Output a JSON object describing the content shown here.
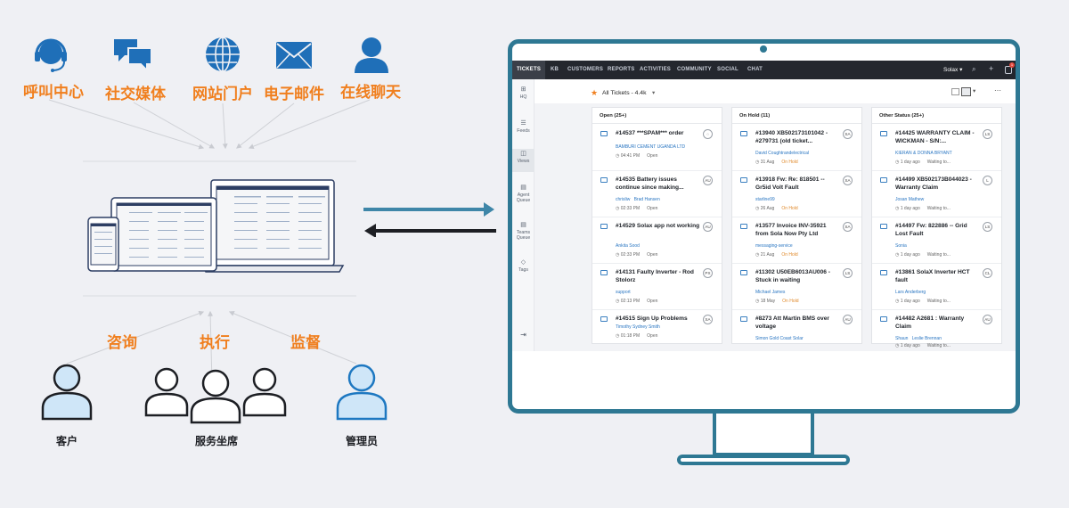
{
  "channels": [
    {
      "label": "呼叫中心",
      "icon": "headset-icon"
    },
    {
      "label": "社交媒体",
      "icon": "chat-bubbles-icon"
    },
    {
      "label": "网站门户",
      "icon": "globe-icon"
    },
    {
      "label": "电子邮件",
      "icon": "envelope-icon"
    },
    {
      "label": "在线聊天",
      "icon": "user-icon"
    }
  ],
  "interactions": [
    "咨询",
    "执行",
    "监督"
  ],
  "roles": {
    "customer": "客户",
    "agents": "服务坐席",
    "admin": "管理员"
  },
  "colors": {
    "accent_orange": "#f07f1e",
    "brand_blue": "#1f6fb8",
    "monitor_frame": "#2e7893",
    "arrow_teal": "#3e86a8",
    "nav_dark": "#24272e"
  },
  "helpdesk": {
    "nav_tabs": [
      "TICKETS",
      "KB",
      "CUSTOMERS",
      "REPORTS",
      "ACTIVITIES",
      "COMMUNITY",
      "SOCIAL",
      "CHAT"
    ],
    "org_name": "Solax",
    "notification_count": "1",
    "sidebar": [
      "HQ",
      "Feeds",
      "Views",
      "Agent Queue",
      "Teams Queue",
      "Tags"
    ],
    "view_title": "All Tickets - 4.4k",
    "columns": [
      {
        "header": "Open (25+)",
        "tickets": [
          {
            "title": "#14537  ***SPAM*** order",
            "contact": "BAMBURI CEMENT UGANDA LTD",
            "agent": "",
            "time": "04:41 PM",
            "status": "Open",
            "avatar": ""
          },
          {
            "title": "#14535  Battery issues continue since making...",
            "contact": "chrisliw",
            "agent": "Brad Hansen",
            "time": "02:33 PM",
            "status": "Open",
            "avatar": "AU"
          },
          {
            "title": "#14529  Solax app not working",
            "contact": "Ankita Sood",
            "agent": "",
            "time": "02:33 PM",
            "status": "Open",
            "avatar": "AU"
          },
          {
            "title": "#14131  Faulty Inverter - Rod Stolorz",
            "contact": "support",
            "agent": "",
            "time": "02:13 PM",
            "status": "Open",
            "avatar": "PX"
          },
          {
            "title": "#14515  Sign Up Problems",
            "contact": "Timothy Sydney Smith",
            "agent": "",
            "time": "01:18 PM",
            "status": "Open",
            "avatar": "SA"
          }
        ]
      },
      {
        "header": "On Hold (11)",
        "tickets": [
          {
            "title": "#13940  XB502173101042 - #279731 (old ticket...",
            "contact": "David Coughtrandelectrical",
            "agent": "",
            "time": "31 Aug",
            "status": "On Hold",
            "avatar": "SA"
          },
          {
            "title": "#13918  Fw: Re: 818501 -- Gr5id Volt Fault",
            "contact": "starline99",
            "agent": "",
            "time": "26 Aug",
            "status": "On Hold",
            "avatar": "SA"
          },
          {
            "title": "#13577  Invoice INV-35921 from Sola Now Pty Ltd",
            "contact": "messaging-service",
            "agent": "",
            "time": "21 Aug",
            "status": "On Hold",
            "avatar": "SA"
          },
          {
            "title": "#11302  U50EB6013AU006 - Stuck in waiting",
            "contact": "Michael James",
            "agent": "",
            "time": "18 May",
            "status": "On Hold",
            "avatar": "LS"
          },
          {
            "title": "#8273  Att Martin BMS over voltage",
            "contact": "Simon Gold Coast Solar",
            "agent": "",
            "time": "",
            "status": "",
            "avatar": "AU"
          }
        ]
      },
      {
        "header": "Other Status (25+)",
        "tickets": [
          {
            "title": "#14425  WARRANTY CLAIM - WICKMAN - S/N:...",
            "contact": "KIERAN & DONNA BRYANT",
            "agent": "",
            "time": "1 day ago",
            "status": "Waiting to...",
            "avatar": "LS"
          },
          {
            "title": "#14499  XB502173B044023 - Warranty Claim",
            "contact": "Josan Mathew",
            "agent": "",
            "time": "1 day ago",
            "status": "Waiting to...",
            "avatar": "L"
          },
          {
            "title": "#14497  Fw: 822886 -- Grid Lost Fault",
            "contact": "Sonia",
            "agent": "",
            "time": "1 day ago",
            "status": "Waiting to...",
            "avatar": "LS"
          },
          {
            "title": "#13861  SolaX Inverter HCT fault",
            "contact": "Lars Anderberg",
            "agent": "",
            "time": "1 day ago",
            "status": "Waiting to...",
            "avatar": "CL"
          },
          {
            "title": "#14482  A2681 : Warranty Claim",
            "contact": "Shaun",
            "agent": "Leslie Brennan",
            "time": "1 day ago",
            "status": "Waiting to...",
            "avatar": "AU"
          }
        ]
      }
    ]
  }
}
